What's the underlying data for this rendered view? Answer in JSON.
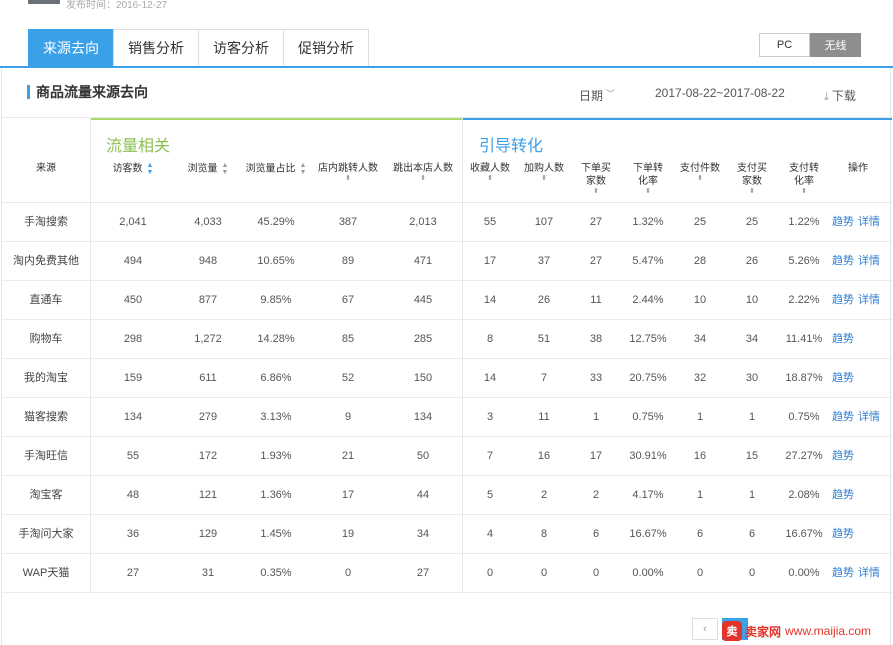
{
  "header": {
    "publish_text": "发布时间：2016-12-27"
  },
  "tabs": [
    {
      "label": "来源去向",
      "active": true
    },
    {
      "label": "销售分析",
      "active": false
    },
    {
      "label": "访客分析",
      "active": false
    },
    {
      "label": "促销分析",
      "active": false
    }
  ],
  "device_toggle": {
    "pc": "PC",
    "wireless": "无线",
    "selected": "无线"
  },
  "panel": {
    "title": "商品流量来源去向",
    "date_label": "日期",
    "date_range": "2017-08-22~2017-08-22",
    "download": "下载"
  },
  "groups": {
    "traffic": "流量相关",
    "conversion": "引导转化"
  },
  "columns": {
    "source": "来源",
    "visitors": "访客数",
    "pageviews": "浏览量",
    "pv_share": "浏览量占比",
    "in_store_jump": "店内跳转人数",
    "exit": "跳出本店人数",
    "favorites": "收藏人数",
    "add_cart": "加购人数",
    "order_buyers": "下单买家数",
    "order_conv": "下单转化率",
    "paid_items": "支付件数",
    "paid_buyers": "支付买家数",
    "pay_conv": "支付转化率",
    "ops": "操作"
  },
  "ops": {
    "trend": "趋势",
    "detail": "详情"
  },
  "rows": [
    {
      "source": "手淘搜索",
      "visitors": "2,041",
      "pageviews": "4,033",
      "pv_share": "45.29%",
      "in_store_jump": "387",
      "exit": "2,013",
      "favorites": "55",
      "add_cart": "107",
      "order_buyers": "27",
      "order_conv": "1.32%",
      "paid_items": "25",
      "paid_buyers": "25",
      "pay_conv": "1.22%",
      "has_detail": true
    },
    {
      "source": "淘内免费其他",
      "visitors": "494",
      "pageviews": "948",
      "pv_share": "10.65%",
      "in_store_jump": "89",
      "exit": "471",
      "favorites": "17",
      "add_cart": "37",
      "order_buyers": "27",
      "order_conv": "5.47%",
      "paid_items": "28",
      "paid_buyers": "26",
      "pay_conv": "5.26%",
      "has_detail": true
    },
    {
      "source": "直通车",
      "visitors": "450",
      "pageviews": "877",
      "pv_share": "9.85%",
      "in_store_jump": "67",
      "exit": "445",
      "favorites": "14",
      "add_cart": "26",
      "order_buyers": "11",
      "order_conv": "2.44%",
      "paid_items": "10",
      "paid_buyers": "10",
      "pay_conv": "2.22%",
      "has_detail": true
    },
    {
      "source": "购物车",
      "visitors": "298",
      "pageviews": "1,272",
      "pv_share": "14.28%",
      "in_store_jump": "85",
      "exit": "285",
      "favorites": "8",
      "add_cart": "51",
      "order_buyers": "38",
      "order_conv": "12.75%",
      "paid_items": "34",
      "paid_buyers": "34",
      "pay_conv": "11.41%",
      "has_detail": false
    },
    {
      "source": "我的淘宝",
      "visitors": "159",
      "pageviews": "611",
      "pv_share": "6.86%",
      "in_store_jump": "52",
      "exit": "150",
      "favorites": "14",
      "add_cart": "7",
      "order_buyers": "33",
      "order_conv": "20.75%",
      "paid_items": "32",
      "paid_buyers": "30",
      "pay_conv": "18.87%",
      "has_detail": false
    },
    {
      "source": "猫客搜索",
      "visitors": "134",
      "pageviews": "279",
      "pv_share": "3.13%",
      "in_store_jump": "9",
      "exit": "134",
      "favorites": "3",
      "add_cart": "11",
      "order_buyers": "1",
      "order_conv": "0.75%",
      "paid_items": "1",
      "paid_buyers": "1",
      "pay_conv": "0.75%",
      "has_detail": true
    },
    {
      "source": "手淘旺信",
      "visitors": "55",
      "pageviews": "172",
      "pv_share": "1.93%",
      "in_store_jump": "21",
      "exit": "50",
      "favorites": "7",
      "add_cart": "16",
      "order_buyers": "17",
      "order_conv": "30.91%",
      "paid_items": "16",
      "paid_buyers": "15",
      "pay_conv": "27.27%",
      "has_detail": false
    },
    {
      "source": "淘宝客",
      "visitors": "48",
      "pageviews": "121",
      "pv_share": "1.36%",
      "in_store_jump": "17",
      "exit": "44",
      "favorites": "5",
      "add_cart": "2",
      "order_buyers": "2",
      "order_conv": "4.17%",
      "paid_items": "1",
      "paid_buyers": "1",
      "pay_conv": "2.08%",
      "has_detail": false
    },
    {
      "source": "手淘问大家",
      "visitors": "36",
      "pageviews": "129",
      "pv_share": "1.45%",
      "in_store_jump": "19",
      "exit": "34",
      "favorites": "4",
      "add_cart": "8",
      "order_buyers": "6",
      "order_conv": "16.67%",
      "paid_items": "6",
      "paid_buyers": "6",
      "pay_conv": "16.67%",
      "has_detail": false
    },
    {
      "source": "WAP天猫",
      "visitors": "27",
      "pageviews": "31",
      "pv_share": "0.35%",
      "in_store_jump": "0",
      "exit": "27",
      "favorites": "0",
      "add_cart": "0",
      "order_buyers": "0",
      "order_conv": "0.00%",
      "paid_items": "0",
      "paid_buyers": "0",
      "pay_conv": "0.00%",
      "has_detail": true
    }
  ],
  "pagination": {
    "prev": "‹",
    "current": "1"
  },
  "watermark": {
    "logo": "卖",
    "text": "卖家网",
    "url": "www.maijia.com"
  },
  "colors": {
    "accent": "#3aa0e8",
    "traffic_green": "#8cc152",
    "link": "#2f7fd3",
    "watermark_red": "#e2342b"
  }
}
